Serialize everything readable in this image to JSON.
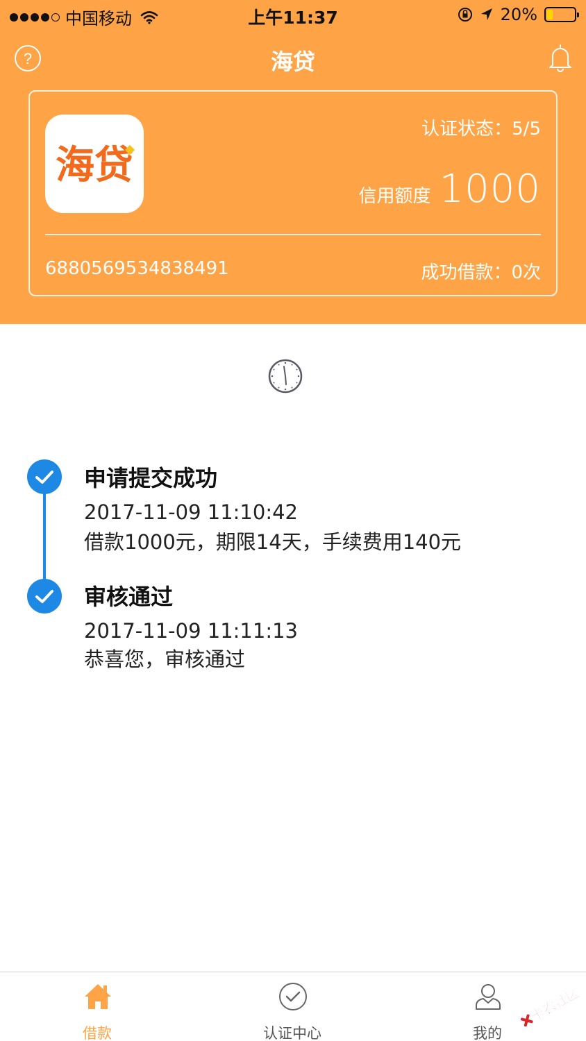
{
  "status_bar": {
    "carrier": "中国移动",
    "time": "上午11:37",
    "battery": "20%",
    "battery_level": 0.2
  },
  "nav": {
    "title": "海贷",
    "help_icon": "question-circle-icon",
    "bell_icon": "bell-icon"
  },
  "card": {
    "logo_text": "海贷",
    "auth_status": "认证状态：5/5",
    "credit_label": "信用额度",
    "credit_value": "1000",
    "account_no": "6880569534838491",
    "loan_count": "成功借款：0次"
  },
  "timeline": [
    {
      "title": "申请提交成功",
      "time": "2017-11-09 11:10:42",
      "desc": "借款1000元，期限14天，手续费用140元"
    },
    {
      "title": "审核通过",
      "time": "2017-11-09 11:11:13",
      "desc": "恭喜您，审核通过"
    }
  ],
  "tabs": [
    {
      "label": "借款",
      "icon": "home-icon",
      "active": true
    },
    {
      "label": "认证中心",
      "icon": "check-circle-icon",
      "active": false
    },
    {
      "label": "我的",
      "icon": "user-icon",
      "active": false
    }
  ],
  "watermark": "卡农社区",
  "colors": {
    "header": "#FFA446",
    "timeline": "#1E88E5",
    "logo_text": "#F26B1D"
  }
}
